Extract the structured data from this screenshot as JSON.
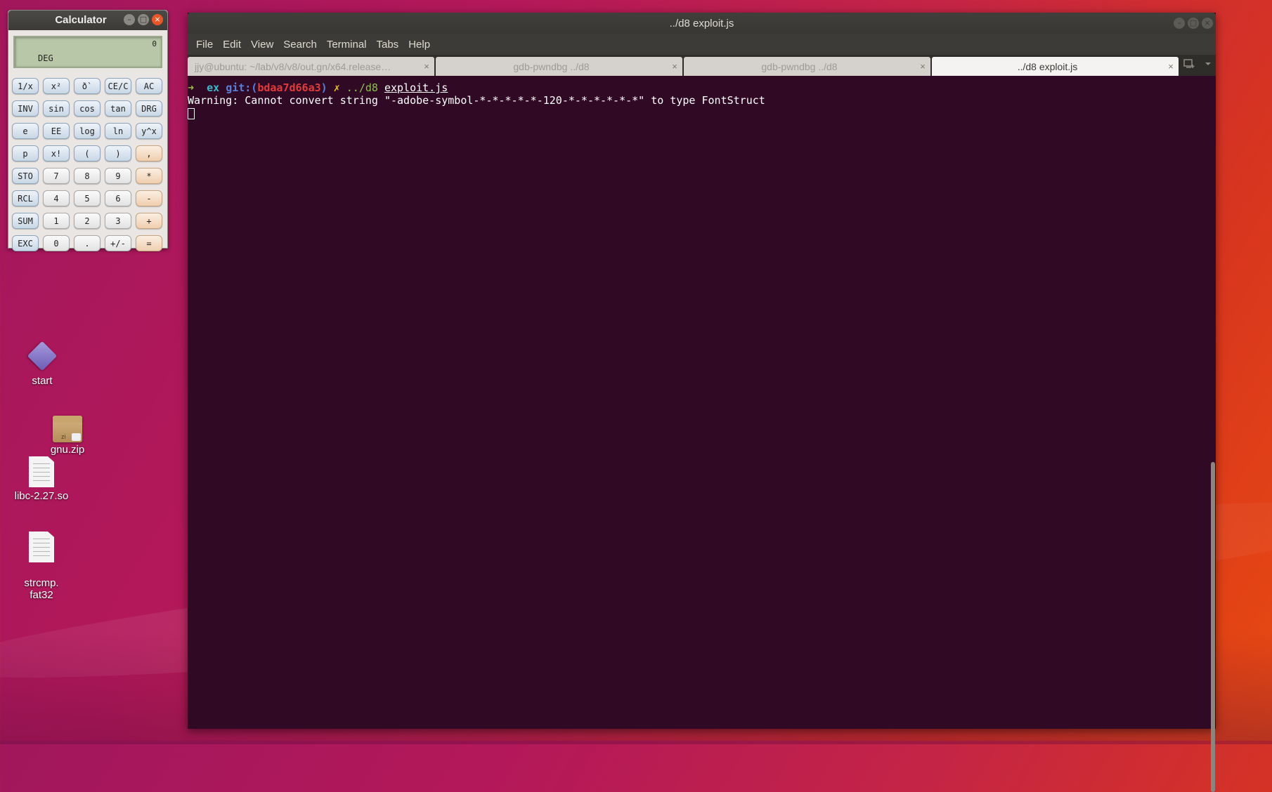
{
  "calculator": {
    "title": "Calculator",
    "display_value": "0",
    "display_mode": "DEG",
    "window_controls": [
      "–",
      "□",
      "×"
    ],
    "buttons": [
      {
        "label": "1/x",
        "kind": "fn"
      },
      {
        "label": "x²",
        "kind": "fn"
      },
      {
        "label": "ð`",
        "kind": "fn"
      },
      {
        "label": "CE/C",
        "kind": "fn"
      },
      {
        "label": "AC",
        "kind": "fn"
      },
      {
        "label": "INV",
        "kind": "fn"
      },
      {
        "label": "sin",
        "kind": "fn"
      },
      {
        "label": "cos",
        "kind": "fn"
      },
      {
        "label": "tan",
        "kind": "fn"
      },
      {
        "label": "DRG",
        "kind": "fn"
      },
      {
        "label": "e",
        "kind": "fn"
      },
      {
        "label": "EE",
        "kind": "fn"
      },
      {
        "label": "log",
        "kind": "fn"
      },
      {
        "label": "ln",
        "kind": "fn"
      },
      {
        "label": "y^x",
        "kind": "fn"
      },
      {
        "label": "p",
        "kind": "fn"
      },
      {
        "label": "x!",
        "kind": "fn"
      },
      {
        "label": "(",
        "kind": "fn"
      },
      {
        "label": ")",
        "kind": "fn"
      },
      {
        "label": ",",
        "kind": "op"
      },
      {
        "label": "STO",
        "kind": "fn"
      },
      {
        "label": "7",
        "kind": "num"
      },
      {
        "label": "8",
        "kind": "num"
      },
      {
        "label": "9",
        "kind": "num"
      },
      {
        "label": "*",
        "kind": "op"
      },
      {
        "label": "RCL",
        "kind": "fn"
      },
      {
        "label": "4",
        "kind": "num"
      },
      {
        "label": "5",
        "kind": "num"
      },
      {
        "label": "6",
        "kind": "num"
      },
      {
        "label": "-",
        "kind": "op"
      },
      {
        "label": "SUM",
        "kind": "fn"
      },
      {
        "label": "1",
        "kind": "num"
      },
      {
        "label": "2",
        "kind": "num"
      },
      {
        "label": "3",
        "kind": "num"
      },
      {
        "label": "+",
        "kind": "op"
      },
      {
        "label": "EXC",
        "kind": "fn"
      },
      {
        "label": "0",
        "kind": "num"
      },
      {
        "label": ".",
        "kind": "num"
      },
      {
        "label": "+/-",
        "kind": "num"
      },
      {
        "label": "=",
        "kind": "op"
      }
    ]
  },
  "desktop": {
    "icons": [
      {
        "label": "start",
        "icon": "executable-diamond-icon"
      },
      {
        "label": "gnu.zip",
        "icon": "zip-archive-icon",
        "badge": "zi"
      },
      {
        "label": "libc-2.27.so",
        "icon": "text-file-icon"
      },
      {
        "label": "strcmp.\nfat32",
        "icon": "text-file-icon"
      }
    ]
  },
  "terminal": {
    "title": "../d8 exploit.js",
    "window_controls": [
      "–",
      "□",
      "×"
    ],
    "menu": [
      "File",
      "Edit",
      "View",
      "Search",
      "Terminal",
      "Tabs",
      "Help"
    ],
    "tabs": [
      {
        "label": "jjy@ubuntu: ~/lab/v8/v8/out.gn/x64.release…",
        "active": false
      },
      {
        "label": "gdb-pwndbg ../d8",
        "active": false
      },
      {
        "label": "gdb-pwndbg ../d8",
        "active": false
      },
      {
        "label": "../d8 exploit.js",
        "active": true
      }
    ],
    "tab_close": "×",
    "tab_extras": [
      "new-tab-icon",
      "tab-menu-icon"
    ],
    "prompt": {
      "arrow": "➜",
      "dir": "ex",
      "git_label": "git:(",
      "hash": "bdaa7d66a3",
      "git_close": ")",
      "dirty_mark": "✗",
      "command": "../d8",
      "argument": "exploit.js"
    },
    "output": [
      "Warning: Cannot convert string \"-adobe-symbol-*-*-*-*-*-120-*-*-*-*-*-*\" to type FontStruct"
    ]
  },
  "colors": {
    "terminal_bg": "#300a24",
    "prompt_arrow": "#9ac14d",
    "git_hash": "#e23b3b"
  }
}
